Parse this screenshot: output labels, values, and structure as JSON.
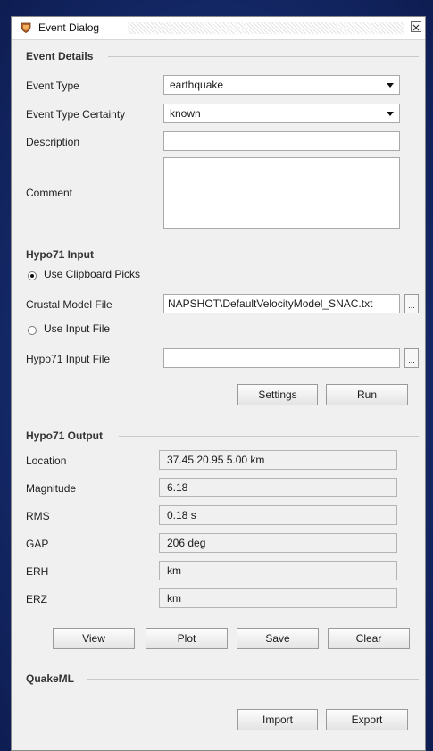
{
  "window": {
    "title": "Event Dialog",
    "close_symbol": "✕"
  },
  "event_details": {
    "section_title": "Event Details",
    "event_type_label": "Event Type",
    "event_type_value": "earthquake",
    "certainty_label": "Event Type Certainty",
    "certainty_value": "known",
    "description_label": "Description",
    "description_value": "",
    "comment_label": "Comment",
    "comment_value": ""
  },
  "hypo71_input": {
    "section_title": "Hypo71 Input",
    "use_clipboard_label": "Use Clipboard Picks",
    "crustal_model_label": "Crustal Model File",
    "crustal_model_value": "NAPSHOT\\DefaultVelocityModel_SNAC.txt",
    "use_input_file_label": "Use Input File",
    "input_file_label": "Hypo71 Input File",
    "input_file_value": "",
    "browse_label": "...",
    "settings_label": "Settings",
    "run_label": "Run"
  },
  "hypo71_output": {
    "section_title": "Hypo71 Output",
    "location_label": "Location",
    "location_value": "37.45  20.95  5.00 km",
    "magnitude_label": "Magnitude",
    "magnitude_value": "6.18",
    "rms_label": "RMS",
    "rms_value": "0.18 s",
    "gap_label": "GAP",
    "gap_value": "206 deg",
    "erh_label": "ERH",
    "erh_value": "km",
    "erz_label": "ERZ",
    "erz_value": "km",
    "view_label": "View",
    "plot_label": "Plot",
    "save_label": "Save",
    "clear_label": "Clear"
  },
  "quakeml": {
    "section_title": "QuakeML",
    "import_label": "Import",
    "export_label": "Export"
  }
}
